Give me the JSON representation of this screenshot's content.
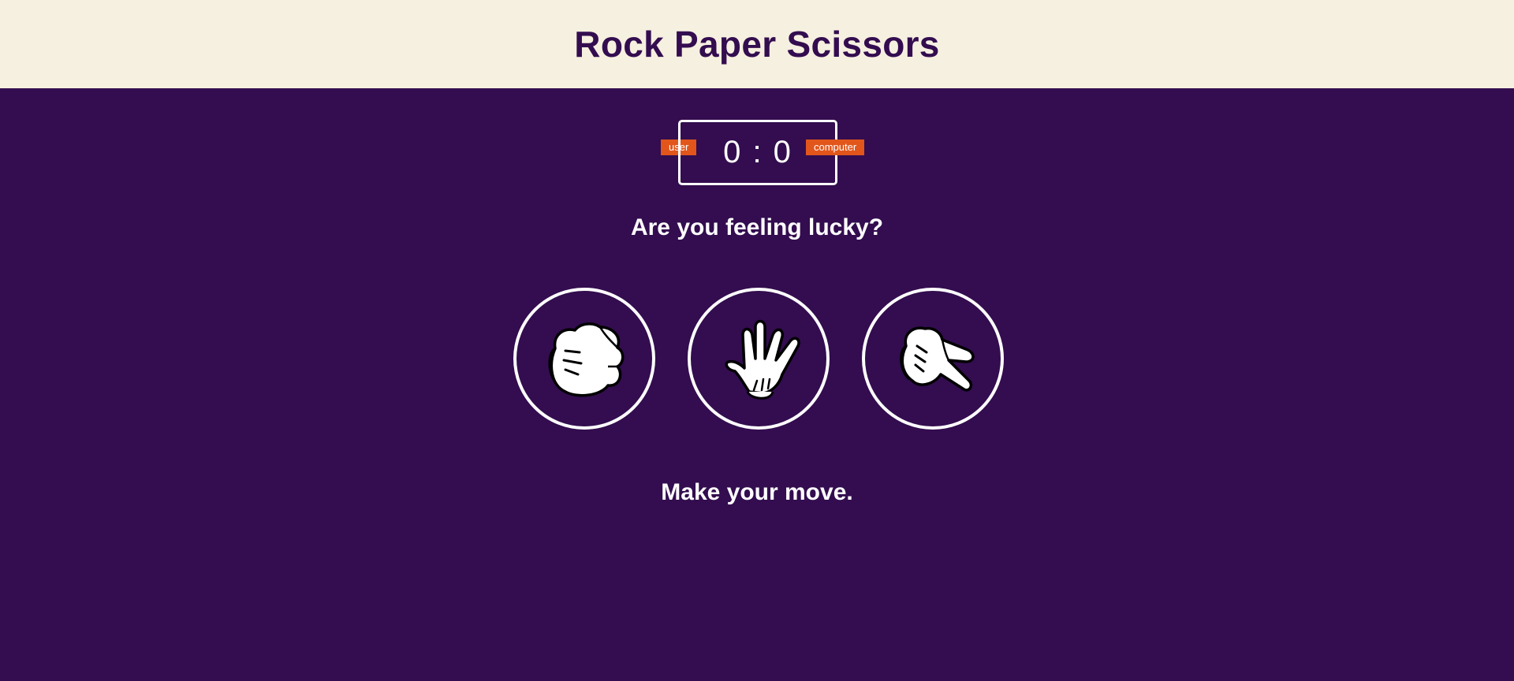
{
  "header": {
    "title": "Rock Paper Scissors"
  },
  "score": {
    "user_label": "user",
    "computer_label": "computer",
    "user_score": 0,
    "computer_score": 0,
    "display": "0 : 0"
  },
  "prompt": "Are you feeling lucky?",
  "status": "Make your move.",
  "choices": [
    {
      "id": "r",
      "name": "rock",
      "icon": "rock-hand-icon"
    },
    {
      "id": "p",
      "name": "paper",
      "icon": "paper-hand-icon"
    },
    {
      "id": "s",
      "name": "scissors",
      "icon": "scissors-hand-icon"
    }
  ],
  "colors": {
    "background": "#330d4f",
    "header_bg": "#f6f0e0",
    "accent": "#e2561b",
    "text": "#ffffff"
  }
}
